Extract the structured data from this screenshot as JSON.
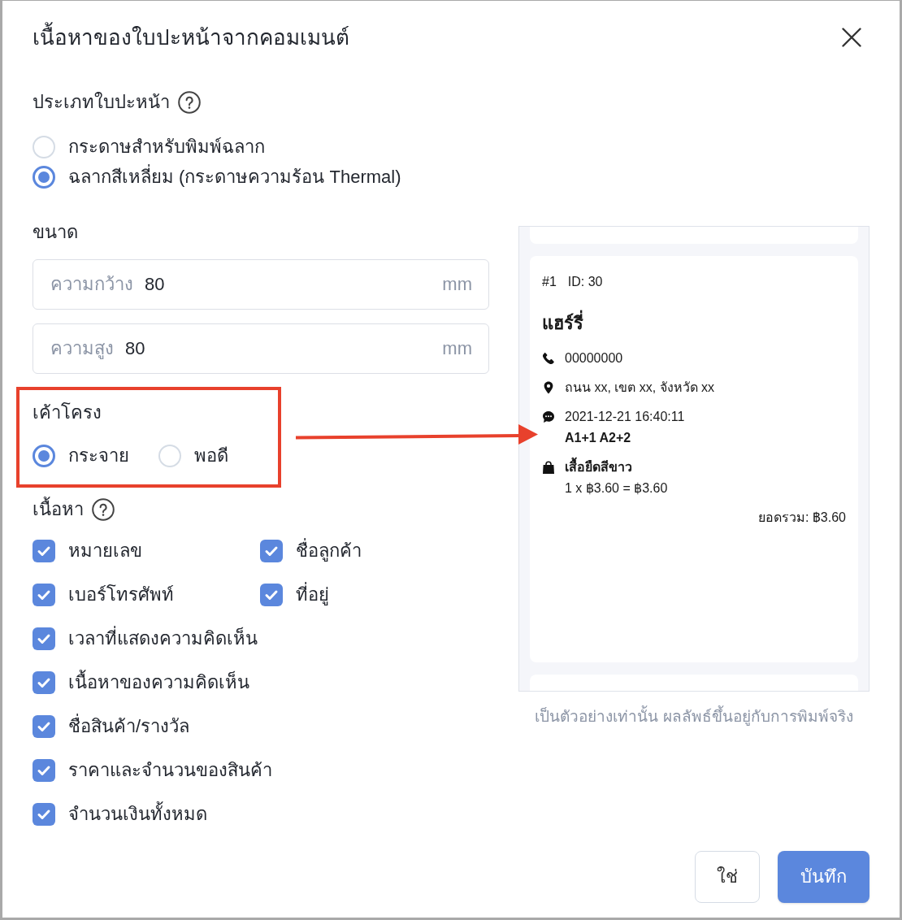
{
  "dialog": {
    "title": "เนื้อหาของใบปะหน้าจากคอมเมนต์"
  },
  "label_type": {
    "label": "ประเภทใบปะหน้า",
    "options": [
      {
        "label": "กระดาษสำหรับพิมพ์ฉลาก",
        "selected": false
      },
      {
        "label": "ฉลากสีเหลี่ยม (กระดาษความร้อน Thermal)",
        "selected": true
      }
    ]
  },
  "size": {
    "label": "ขนาด",
    "fields": [
      {
        "label": "ความกว้าง",
        "value": "80",
        "unit": "mm"
      },
      {
        "label": "ความสูง",
        "value": "80",
        "unit": "mm"
      }
    ]
  },
  "layout": {
    "label": "เค้าโครง",
    "highlighted": true,
    "options": [
      {
        "label": "กระจาย",
        "selected": true
      },
      {
        "label": "พอดี",
        "selected": false
      }
    ]
  },
  "content": {
    "label": "เนื้อหา",
    "rows": [
      [
        {
          "label": "หมายเลข",
          "checked": true
        },
        {
          "label": "ชื่อลูกค้า",
          "checked": true
        }
      ],
      [
        {
          "label": "เบอร์โทรศัพท์",
          "checked": true
        },
        {
          "label": "ที่อยู่",
          "checked": true
        }
      ],
      [
        {
          "label": "เวลาที่แสดงความคิดเห็น",
          "checked": true
        }
      ],
      [
        {
          "label": "เนื้อหาของความคิดเห็น",
          "checked": true
        }
      ],
      [
        {
          "label": "ชื่อสินค้า/รางวัล",
          "checked": true
        }
      ],
      [
        {
          "label": "ราคาและจำนวนของสินค้า",
          "checked": true
        }
      ],
      [
        {
          "label": "จำนวนเงินทั้งหมด",
          "checked": true
        }
      ]
    ]
  },
  "preview": {
    "card": {
      "number": "#1",
      "id": "ID: 30",
      "name": "แฮร์รี่",
      "lines": [
        {
          "kind": "phone",
          "text": "00000000"
        },
        {
          "kind": "address",
          "text": "ถนน xx, เขต xx, จังหวัด xx"
        },
        {
          "kind": "comment",
          "text": "2021-12-21 16:40:11",
          "detail": "A1+1 A2+2"
        },
        {
          "kind": "product",
          "text": "เสื้อยืดสีขาว",
          "detail": "1 x ฿3.60 = ฿3.60"
        }
      ],
      "total": "ยอดรวม: ฿3.60"
    },
    "note": "เป็นตัวอย่างเท่านั้น ผลลัพธ์ขึ้นอยู่กับการพิมพ์จริง"
  },
  "buttons": [
    {
      "label": "ใช่",
      "kind": "secondary"
    },
    {
      "label": "บันทึก",
      "kind": "primary"
    }
  ]
}
